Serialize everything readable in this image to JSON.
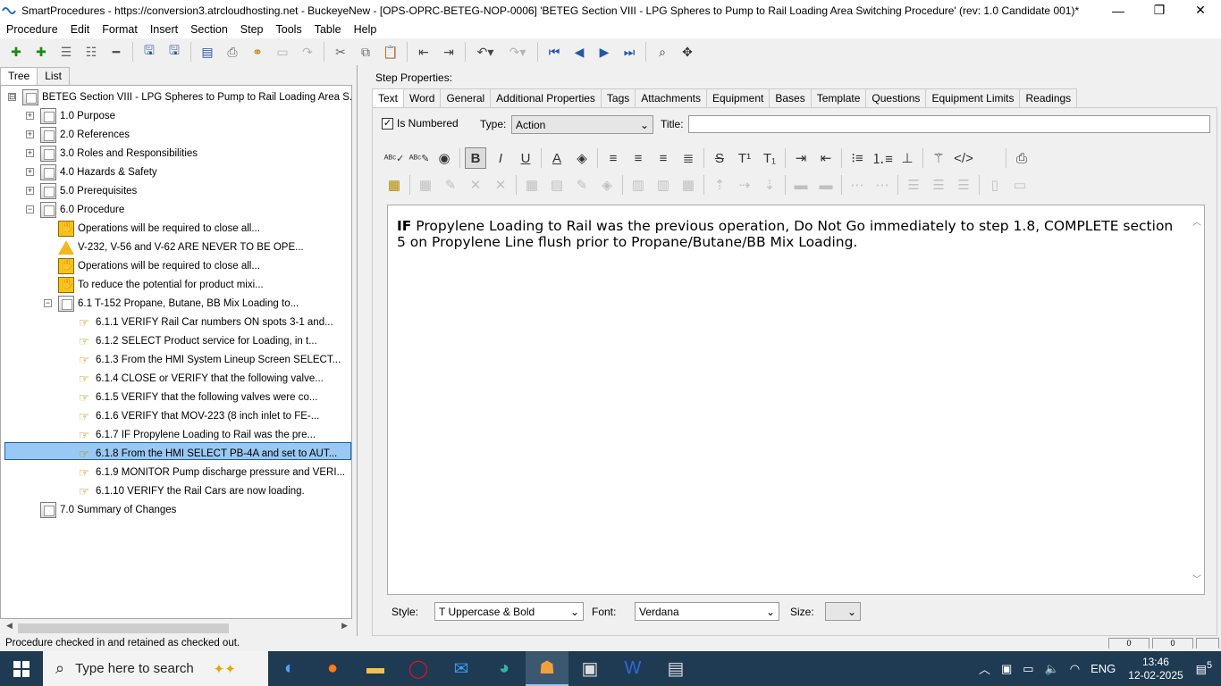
{
  "window": {
    "title": "SmartProcedures - https://conversion3.atrcloudhosting.net - BuckeyeNew - [OPS-OPRC-BETEG-NOP-0006] 'BETEG Section VIII - LPG Spheres to Pump to Rail Loading Area Switching Procedure' (rev: 1.0 Candidate 001)*",
    "minimize": "—",
    "restore": "❐",
    "close": "✕"
  },
  "menu": [
    "Procedure",
    "Edit",
    "Format",
    "Insert",
    "Section",
    "Step",
    "Tools",
    "Table",
    "Help"
  ],
  "left": {
    "tabs": [
      "Tree",
      "List"
    ],
    "tree": [
      {
        "label": "BETEG Section VIII - LPG Spheres to Pump to Rail Loading Area S...",
        "icon": "folder",
        "exp": "⊟"
      },
      {
        "label": "1.0 Purpose",
        "icon": "folder",
        "exp": "+"
      },
      {
        "label": "2.0 References",
        "icon": "folder",
        "exp": "+"
      },
      {
        "label": "3.0 Roles and Responsibilities",
        "icon": "folder",
        "exp": "+"
      },
      {
        "label": "4.0 Hazards & Safety",
        "icon": "folder",
        "exp": "+"
      },
      {
        "label": "5.0 Prerequisites",
        "icon": "folder",
        "exp": "+"
      },
      {
        "label": "6.0 Procedure",
        "icon": "folder",
        "exp": "−"
      },
      {
        "label": "Operations will be required to close all...",
        "icon": "caution"
      },
      {
        "label": "V-232, V-56 and V-62 ARE NEVER TO BE OPE...",
        "icon": "warning"
      },
      {
        "label": "Operations will be required to close all...",
        "icon": "caution"
      },
      {
        "label": "To reduce the potential for product mixi...",
        "icon": "caution"
      },
      {
        "label": "6.1 T-152 Propane, Butane, BB Mix Loading to...",
        "icon": "folder",
        "exp": "−"
      },
      {
        "label": "6.1.1 VERIFY Rail Car numbers ON spots 3-1 and...",
        "icon": "step"
      },
      {
        "label": "6.1.2 SELECT Product service for Loading, in t...",
        "icon": "step"
      },
      {
        "label": "6.1.3 From the HMI System Lineup Screen SELECT...",
        "icon": "step"
      },
      {
        "label": "6.1.4 CLOSE or VERIFY that the following valve...",
        "icon": "step"
      },
      {
        "label": "6.1.5 VERIFY that the following valves were co...",
        "icon": "step"
      },
      {
        "label": "6.1.6 VERIFY that MOV-223 (8 inch inlet to FE-...",
        "icon": "step"
      },
      {
        "label": "6.1.7 IF Propylene Loading to Rail was the pre...",
        "icon": "step"
      },
      {
        "label": "6.1.8 From the HMI SELECT PB-4A and set to AUT...",
        "icon": "step"
      },
      {
        "label": "6.1.9 MONITOR Pump discharge pressure and VERI...",
        "icon": "step"
      },
      {
        "label": "6.1.10 VERIFY the Rail Cars are now loading.",
        "icon": "step"
      },
      {
        "label": "7.0 Summary of Changes",
        "icon": "folder"
      }
    ]
  },
  "right": {
    "header": "Step Properties:",
    "tabs": [
      "Text",
      "Word",
      "General",
      "Additional Properties",
      "Tags",
      "Attachments",
      "Equipment",
      "Bases",
      "Template",
      "Questions",
      "Equipment Limits",
      "Readings"
    ],
    "is_numbered_label": "Is Numbered",
    "is_numbered_checked": "✓",
    "type_label": "Type:",
    "type_value": "Action",
    "title_label": "Title:",
    "title_value": "",
    "editor": {
      "bold_word": "IF",
      "text": " Propylene Loading to Rail was the previous operation, Do Not Go immediately to step 1.8, COMPLETE section 5 on Propylene Line flush prior to Propane/Butane/BB Mix Loading."
    },
    "style_label": "Style:",
    "style_value": "T  Uppercase & Bold",
    "font_label": "Font:",
    "font_value": "Verdana",
    "size_label": "Size:",
    "size_value": ""
  },
  "status": {
    "text": "Procedure checked in and retained as checked out.",
    "panel1": "0",
    "panel2": "0"
  },
  "taskbar": {
    "search_placeholder": "Type here to search",
    "lang": "ENG",
    "time": "13:46",
    "date": "12-02-2025",
    "notifications": "5"
  },
  "colors": {
    "selection": "#99c9f2",
    "taskbar": "#1f3a53",
    "accent": "#2357a8"
  }
}
